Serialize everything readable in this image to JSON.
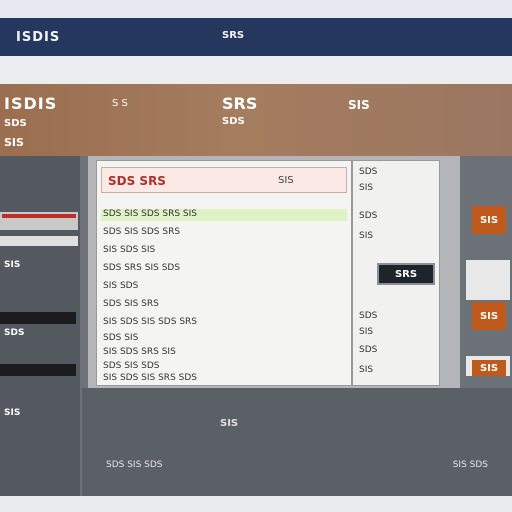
{
  "navbar": {
    "brand": "ISDIS",
    "center": "SRS"
  },
  "header": {
    "title_left": "ISDIS",
    "title_left_sub": "S S",
    "title_left_line2": "SDS",
    "title_left_line3": "SIS",
    "title_center": "SRS",
    "title_center_sub": "SDS",
    "title_right": "SIS"
  },
  "sidebar": {
    "label_1": "SIS",
    "label_2": "SDS",
    "label_3": "SIS"
  },
  "doc": {
    "header_title": "SDS SRS",
    "header_aux": "SIS",
    "rows": [
      "SDS SIS SDS SRS SIS",
      "SDS SIS SDS SRS",
      "SIS SDS SIS",
      "SDS SRS SIS SDS",
      "SIS SDS",
      "SDS SIS SRS",
      "SIS SDS SIS SDS SRS",
      "SDS SIS",
      "SIS SDS SRS SIS",
      "SDS SIS SDS",
      "SIS SDS SIS SRS SDS"
    ]
  },
  "rpanel": {
    "rows": [
      "SDS",
      "SIS",
      "SDS",
      "SIS",
      "SDS",
      "SIS",
      "SDS",
      "SIS"
    ],
    "button_label": "SRS"
  },
  "rside": {
    "badge_1": "SIS",
    "badge_2": "SIS",
    "badge_3": "SIS"
  },
  "lower": {
    "center_text": "SIS"
  },
  "footer": {
    "left": "SDS SIS SDS",
    "right": "SIS SDS"
  }
}
